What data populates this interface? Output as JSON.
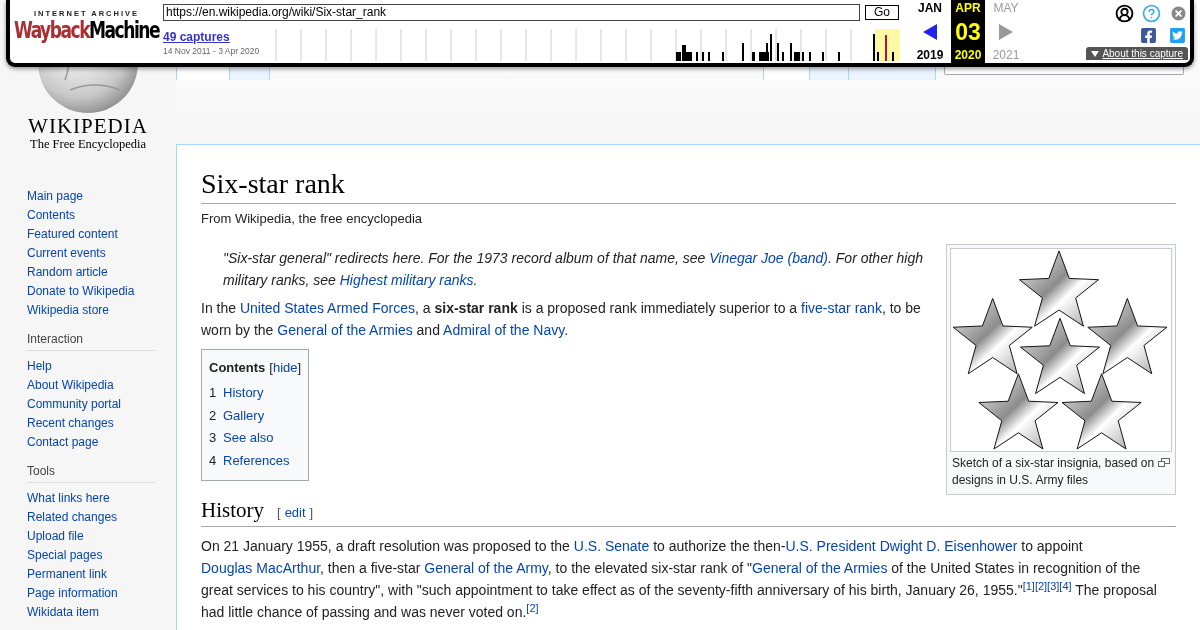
{
  "wayback": {
    "brand_top": "INTERNET ARCHIVE",
    "brand_first": "Wayback",
    "brand_second": "Machine",
    "url": "https://en.wikipedia.org/wiki/Six-star_rank",
    "go": "Go",
    "captures": "49 captures",
    "range": "14 Nov 2011 - 3 Apr 2020",
    "months": [
      {
        "label": "JAN",
        "year": "2019",
        "selected": false,
        "disabled": false
      },
      {
        "label": "APR",
        "day": "03",
        "year": "2020",
        "selected": true,
        "disabled": false
      },
      {
        "label": "MAY",
        "year": "2021",
        "selected": false,
        "disabled": true
      }
    ],
    "about": "About this capture"
  },
  "logo": {
    "title": "WIKIPEDIA",
    "tagline": "The Free Encyclopedia"
  },
  "tabs_left": [
    {
      "selected": false
    },
    {
      "selected": true
    }
  ],
  "tabs_right": [
    {
      "selected": false
    },
    {
      "selected": true
    },
    {
      "selected": true
    }
  ],
  "sidebar": [
    {
      "items": [
        "Main page",
        "Contents",
        "Featured content",
        "Current events",
        "Random article",
        "Donate to Wikipedia",
        "Wikipedia store"
      ]
    },
    {
      "heading": "Interaction",
      "items": [
        "Help",
        "About Wikipedia",
        "Community portal",
        "Recent changes",
        "Contact page"
      ]
    },
    {
      "heading": "Tools",
      "items": [
        "What links here",
        "Related changes",
        "Upload file",
        "Special pages",
        "Permanent link",
        "Page information",
        "Wikidata item"
      ]
    }
  ],
  "article": {
    "title": "Six-star rank",
    "tagline": "From Wikipedia, the free encyclopedia",
    "hatnote": [
      {
        "kind": "text",
        "text": "\"Six-star general\" redirects here. For the 1973 record album of that name, see "
      },
      {
        "kind": "link",
        "text": "Vinegar Joe (band)"
      },
      {
        "kind": "text",
        "text": ". For other high military ranks, see "
      },
      {
        "kind": "link",
        "text": "Highest military ranks"
      },
      {
        "kind": "text",
        "text": "."
      }
    ],
    "lead": [
      {
        "kind": "text",
        "text": "In the "
      },
      {
        "kind": "link",
        "text": "United States Armed Forces"
      },
      {
        "kind": "text",
        "text": ", a "
      },
      {
        "kind": "bold",
        "text": "six-star rank"
      },
      {
        "kind": "text",
        "text": " is a proposed rank immediately superior to a "
      },
      {
        "kind": "link",
        "text": "five-star rank"
      },
      {
        "kind": "text",
        "text": ", to be worn by the "
      },
      {
        "kind": "link",
        "text": "General of the Armies"
      },
      {
        "kind": "text",
        "text": " and "
      },
      {
        "kind": "link",
        "text": "Admiral of the Navy"
      },
      {
        "kind": "text",
        "text": "."
      }
    ],
    "toc": {
      "title": "Contents",
      "open": "[",
      "toggle": "hide",
      "close": "]",
      "items": [
        {
          "number": "1",
          "label": "History"
        },
        {
          "number": "2",
          "label": "Gallery"
        },
        {
          "number": "3",
          "label": "See also"
        },
        {
          "number": "4",
          "label": "References"
        }
      ]
    },
    "figure": {
      "caption": "Sketch of a six-star insignia, based on designs in U.S. Army files"
    },
    "sections": [
      {
        "heading": "History",
        "edit_open": "[",
        "edit": "edit",
        "edit_close": "]",
        "paragraph": [
          {
            "kind": "text",
            "text": "On 21 January 1955, a draft resolution was proposed to the "
          },
          {
            "kind": "link",
            "text": "U.S. Senate"
          },
          {
            "kind": "text",
            "text": " to authorize the then-"
          },
          {
            "kind": "link",
            "text": "U.S. President Dwight D. Eisenhower"
          },
          {
            "kind": "text",
            "text": " to appoint "
          },
          {
            "kind": "link",
            "text": "Douglas MacArthur"
          },
          {
            "kind": "text",
            "text": ", then a five-star "
          },
          {
            "kind": "link",
            "text": "General of the Army"
          },
          {
            "kind": "text",
            "text": ", to the elevated six-star rank of \""
          },
          {
            "kind": "link",
            "text": "General of the Armies"
          },
          {
            "kind": "text",
            "text": " of the United States in recognition of the great services to his country\", with \"such appointment to take effect as of the seventy-fifth anniversary of his birth, January 26, 1955.\""
          },
          {
            "kind": "ref",
            "text": "[1]"
          },
          {
            "kind": "ref",
            "text": "[2]"
          },
          {
            "kind": "ref",
            "text": "[3]"
          },
          {
            "kind": "ref",
            "text": "[4]"
          },
          {
            "kind": "text",
            "text": " The proposal had little chance of passing and was never voted on."
          },
          {
            "kind": "ref",
            "text": "[2]"
          }
        ]
      }
    ]
  }
}
